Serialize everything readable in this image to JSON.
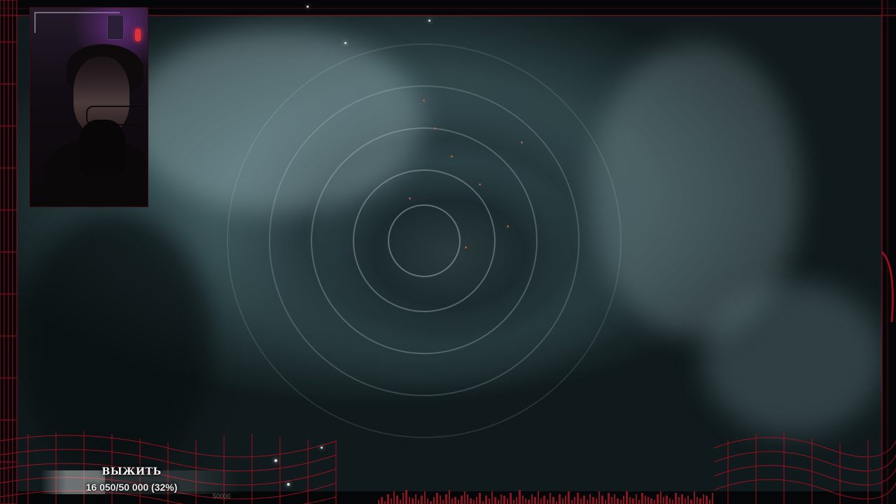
{
  "stream": {
    "webcam_label": "",
    "goal": {
      "title": "ВЫЖИТЬ",
      "progress_text": "16 050/50 000 (32%)",
      "current": 16050,
      "target": 50000,
      "percent": 32,
      "sub_label": "50000"
    }
  },
  "colors": {
    "frame_accent": "#c4121f",
    "goal_text": "#f4f4f4"
  },
  "icons": {
    "frame": "red-wireframe-grid",
    "equalizer": "audio-equalizer-bars"
  }
}
